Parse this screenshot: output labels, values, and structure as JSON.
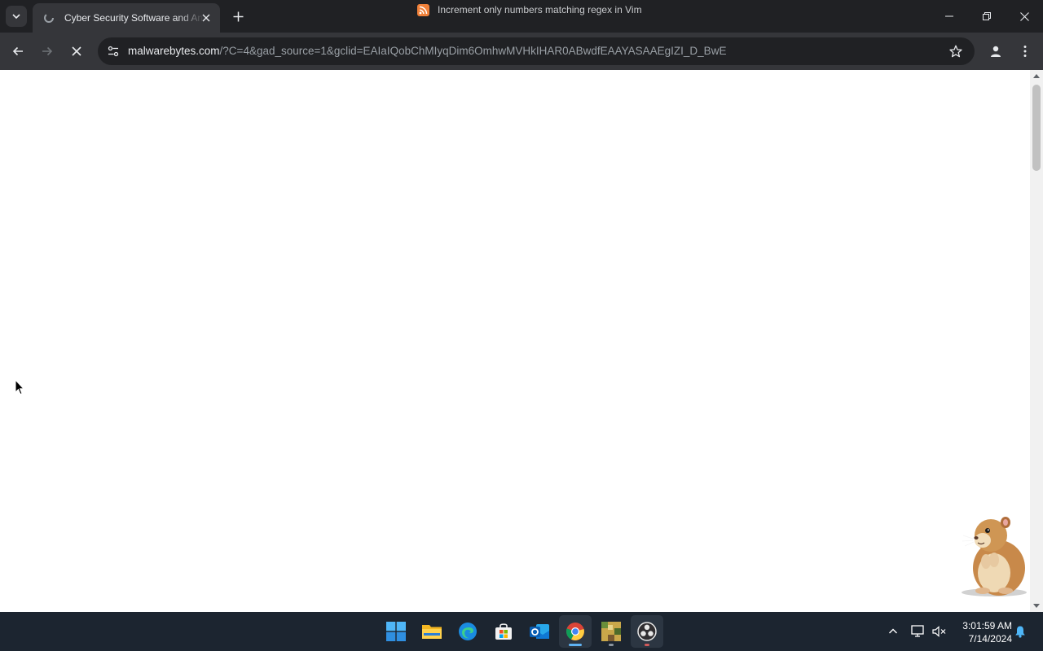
{
  "browser": {
    "tab": {
      "title": "Cyber Security Software and Anti-Malware"
    },
    "media_hint": {
      "title": "Increment only numbers matching regex in Vim",
      "icon": "rss-icon"
    },
    "address_bar": {
      "host": "malwarebytes.com",
      "path": "/?C=4&gad_source=1&gclid=EAIaIQobChMIyqDim6OmhwMVHkIHAR0ABwdfEAAYASAAEgIZI_D_BwE"
    }
  },
  "page": {
    "loading": true
  },
  "taskbar": {
    "apps": [
      "windows-start",
      "file-explorer",
      "edge",
      "microsoft-store",
      "outlook",
      "chrome",
      "minecraft",
      "obs-studio"
    ],
    "clock": {
      "time": "3:01:59 AM",
      "date": "7/14/2024"
    }
  },
  "colors": {
    "tab_strip": "#202124",
    "toolbar": "#35363a",
    "taskbar": "#1c2530",
    "accent": "#5fb2f2"
  }
}
